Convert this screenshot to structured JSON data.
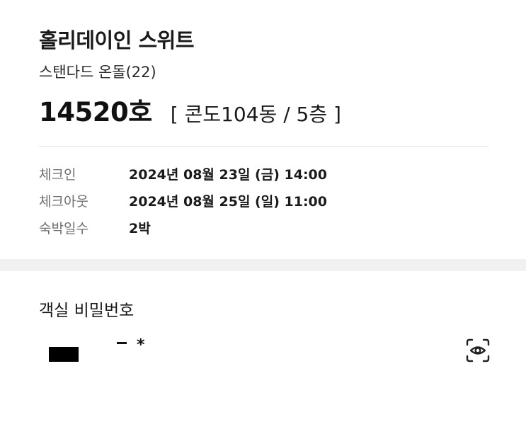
{
  "reservation": {
    "hotel_name": "홀리데이인 스위트",
    "room_type": "스탠다드 온돌(22)",
    "room_number": "14520호",
    "room_location": "[ 콘도104동 / 5층 ]"
  },
  "details": [
    {
      "label": "체크인",
      "value": "2024년 08월 23일 (금) 14:00"
    },
    {
      "label": "체크아웃",
      "value": "2024년 08월 25일 (일) 11:00"
    },
    {
      "label": "숙박일수",
      "value": "2박"
    }
  ],
  "room_password": {
    "title": "객실 비밀번호",
    "visible_text": "*",
    "icon": "eye-icon"
  }
}
